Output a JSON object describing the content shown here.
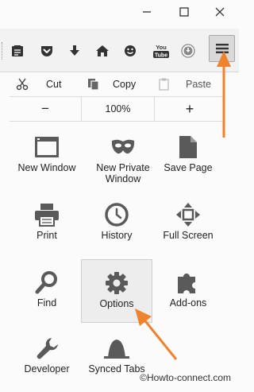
{
  "window": {
    "controls": [
      "minimize-icon",
      "maximize-icon",
      "close-icon"
    ]
  },
  "toolbar": {
    "icons": [
      "reading-list-icon",
      "pocket-icon",
      "download-icon",
      "home-icon",
      "smiley-icon",
      "youtube-icon",
      "download-circle-icon"
    ],
    "youtube_text": "You Tube",
    "menu_icon": "hamburger-menu-icon"
  },
  "edit": {
    "cut": "Cut",
    "copy": "Copy",
    "paste": "Paste"
  },
  "zoom": {
    "out": "−",
    "level": "100%",
    "in": "+"
  },
  "menu_items": [
    {
      "label": "New Window",
      "icon": "window-icon"
    },
    {
      "label": "New Private Window",
      "icon": "mask-icon"
    },
    {
      "label": "Save Page",
      "icon": "page-icon"
    },
    {
      "label": "Print",
      "icon": "printer-icon"
    },
    {
      "label": "History",
      "icon": "clock-icon"
    },
    {
      "label": "Full Screen",
      "icon": "fullscreen-icon"
    },
    {
      "label": "Find",
      "icon": "magnifier-icon"
    },
    {
      "label": "Options",
      "icon": "gear-icon",
      "highlighted": true
    },
    {
      "label": "Add-ons",
      "icon": "puzzle-icon"
    },
    {
      "label": "Developer",
      "icon": "wrench-icon"
    },
    {
      "label": "Synced Tabs",
      "icon": "synced-tabs-icon"
    }
  ],
  "watermark": "©Howto-connect.com",
  "annotation_color": "#f0822e"
}
